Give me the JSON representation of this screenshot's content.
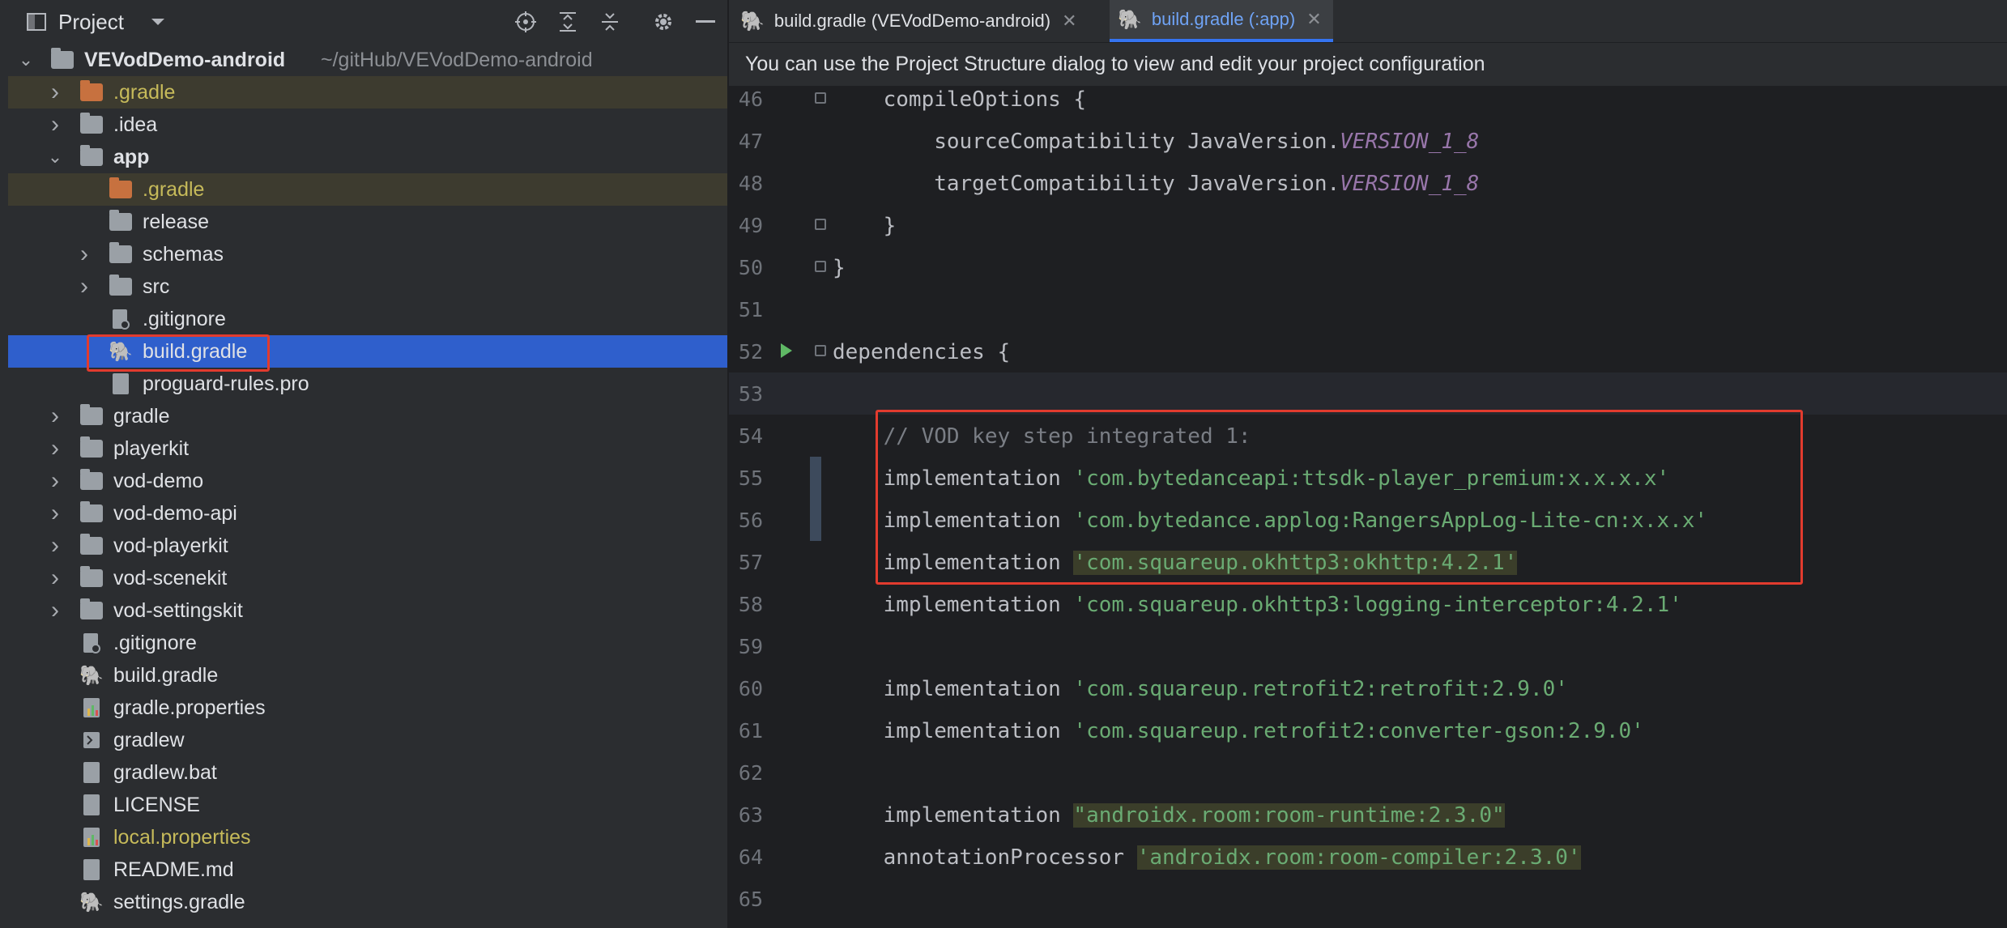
{
  "project_panel": {
    "title": "Project",
    "header_icons": [
      "window-icon",
      "dropdown-arrow-icon",
      "locate-icon",
      "expand-all-icon",
      "collapse-all-icon",
      "gear-icon",
      "minimize-icon"
    ],
    "tree": [
      {
        "label": "VEVodDemo-android",
        "sub": "~/gitHub/VEVodDemo-android",
        "icon": "module-folder-icon",
        "chevron": "down",
        "bold": true
      },
      {
        "label": ".gradle",
        "icon": "folder-icon",
        "chevron": "right",
        "color": "yellow"
      },
      {
        "label": ".idea",
        "icon": "folder-icon",
        "chevron": "right"
      },
      {
        "label": "app",
        "icon": "module-folder-icon",
        "chevron": "down",
        "bold": true
      },
      {
        "label": ".gradle",
        "icon": "folder-icon",
        "chevron": "",
        "color": "yellow"
      },
      {
        "label": "release",
        "icon": "folder-icon",
        "chevron": ""
      },
      {
        "label": "schemas",
        "icon": "folder-icon",
        "chevron": "right"
      },
      {
        "label": "src",
        "icon": "folder-icon",
        "chevron": "right"
      },
      {
        "label": ".gitignore",
        "icon": "gitignore-icon",
        "chevron": ""
      },
      {
        "label": "build.gradle",
        "icon": "gradle-icon",
        "chevron": "",
        "selected": true
      },
      {
        "label": "proguard-rules.pro",
        "icon": "text-file-icon",
        "chevron": ""
      },
      {
        "label": "gradle",
        "icon": "folder-icon",
        "chevron": "right"
      },
      {
        "label": "playerkit",
        "icon": "folder-icon",
        "chevron": "right"
      },
      {
        "label": "vod-demo",
        "icon": "folder-icon",
        "chevron": "right"
      },
      {
        "label": "vod-demo-api",
        "icon": "folder-icon",
        "chevron": "right"
      },
      {
        "label": "vod-playerkit",
        "icon": "folder-icon",
        "chevron": "right"
      },
      {
        "label": "vod-scenekit",
        "icon": "folder-icon",
        "chevron": "right"
      },
      {
        "label": "vod-settingskit",
        "icon": "folder-icon",
        "chevron": "right"
      },
      {
        "label": ".gitignore",
        "icon": "gitignore-icon",
        "chevron": ""
      },
      {
        "label": "build.gradle",
        "icon": "gradle-icon",
        "chevron": ""
      },
      {
        "label": "gradle.properties",
        "icon": "properties-icon",
        "chevron": ""
      },
      {
        "label": "gradlew",
        "icon": "terminal-file-icon",
        "chevron": ""
      },
      {
        "label": "gradlew.bat",
        "icon": "text-file-icon",
        "chevron": ""
      },
      {
        "label": "LICENSE",
        "icon": "text-file-icon",
        "chevron": ""
      },
      {
        "label": "local.properties",
        "icon": "properties-icon",
        "chevron": "",
        "color": "yellow"
      },
      {
        "label": "README.md",
        "icon": "text-file-icon",
        "chevron": ""
      },
      {
        "label": "settings.gradle",
        "icon": "gradle-icon",
        "chevron": ""
      }
    ]
  },
  "editor": {
    "tabs": [
      {
        "label": "build.gradle (VEVodDemo-android)",
        "active": false
      },
      {
        "label": "build.gradle (:app)",
        "active": true
      }
    ],
    "banner": "You can use the Project Structure dialog to view and edit your project configuration",
    "lines": [
      {
        "num": "46",
        "tokens": [
          {
            "t": "    compileOptions {",
            "c": "kw"
          }
        ]
      },
      {
        "num": "47",
        "tokens": [
          {
            "t": "        sourceCompatibility JavaVersion.",
            "c": "kw"
          },
          {
            "t": "VERSION_1_8",
            "c": "const"
          }
        ]
      },
      {
        "num": "48",
        "tokens": [
          {
            "t": "        targetCompatibility JavaVersion.",
            "c": "kw"
          },
          {
            "t": "VERSION_1_8",
            "c": "const"
          }
        ]
      },
      {
        "num": "49",
        "tokens": [
          {
            "t": "    }",
            "c": "kw"
          }
        ]
      },
      {
        "num": "50",
        "tokens": [
          {
            "t": "}",
            "c": "kw"
          }
        ]
      },
      {
        "num": "51",
        "tokens": []
      },
      {
        "num": "52",
        "tokens": [
          {
            "t": "dependencies {",
            "c": "kw"
          }
        ]
      },
      {
        "num": "53",
        "tokens": []
      },
      {
        "num": "54",
        "tokens": [
          {
            "t": "    // VOD key step integrated 1:",
            "c": "cmt"
          }
        ]
      },
      {
        "num": "55",
        "tokens": [
          {
            "t": "    implementation ",
            "c": "kw"
          },
          {
            "t": "'com.bytedanceapi:ttsdk-player_premium:x.x.x.x'",
            "c": "str"
          }
        ]
      },
      {
        "num": "56",
        "tokens": [
          {
            "t": "    implementation ",
            "c": "kw"
          },
          {
            "t": "'com.bytedance.applog:RangersAppLog-Lite-cn:x.x.x'",
            "c": "str"
          }
        ]
      },
      {
        "num": "57",
        "tokens": [
          {
            "t": "    implementation ",
            "c": "kw"
          },
          {
            "t": "'com.squareup.okhttp3:okhttp:4.2.1'",
            "c": "str hl"
          }
        ]
      },
      {
        "num": "58",
        "tokens": [
          {
            "t": "    implementation ",
            "c": "kw"
          },
          {
            "t": "'com.squareup.okhttp3:logging-interceptor:4.2.1'",
            "c": "str"
          }
        ]
      },
      {
        "num": "59",
        "tokens": []
      },
      {
        "num": "60",
        "tokens": [
          {
            "t": "    implementation ",
            "c": "kw"
          },
          {
            "t": "'com.squareup.retrofit2:retrofit:2.9.0'",
            "c": "str"
          }
        ]
      },
      {
        "num": "61",
        "tokens": [
          {
            "t": "    implementation ",
            "c": "kw"
          },
          {
            "t": "'com.squareup.retrofit2:converter-gson:2.9.0'",
            "c": "str"
          }
        ]
      },
      {
        "num": "62",
        "tokens": []
      },
      {
        "num": "63",
        "tokens": [
          {
            "t": "    implementation ",
            "c": "kw"
          },
          {
            "t": "\"androidx.room:room-runtime:2.3.0\"",
            "c": "str hl"
          }
        ]
      },
      {
        "num": "64",
        "tokens": [
          {
            "t": "    annotationProcessor ",
            "c": "kw"
          },
          {
            "t": "'androidx.room:room-compiler:2.3.0'",
            "c": "str hl"
          }
        ]
      },
      {
        "num": "65",
        "tokens": []
      }
    ]
  },
  "colors": {
    "selection": "#2f5fcc",
    "highlight_box": "#e23b2e",
    "string": "#6aab73",
    "comment": "#7a7e85",
    "constant": "#9876aa"
  }
}
